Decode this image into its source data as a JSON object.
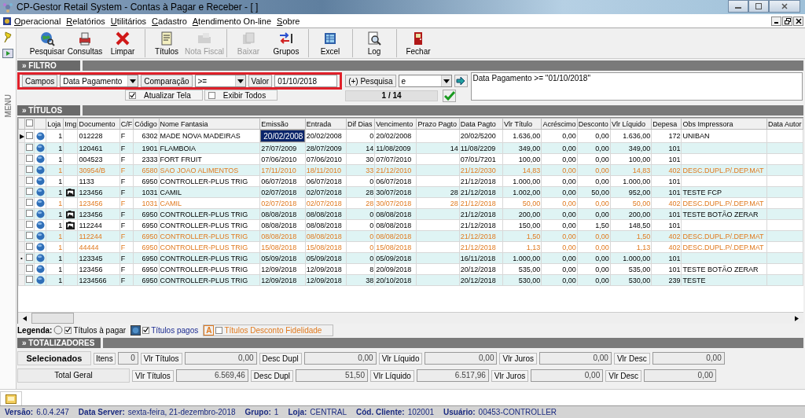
{
  "window": {
    "title": "CP-Gestor Retail System - Contas à Pagar e Receber - [ ]"
  },
  "menu": [
    "Operacional",
    "Relatórios",
    "Utilitários",
    "Cadastro",
    "Atendimento On-line",
    "Sobre"
  ],
  "side_panel": {
    "label": "MENU"
  },
  "toolbar": [
    {
      "label": "Pesquisar",
      "disabled": false,
      "separator_before": false
    },
    {
      "label": "Consultas",
      "disabled": false,
      "separator_before": false
    },
    {
      "label": "Limpar",
      "disabled": false,
      "separator_before": false
    },
    {
      "label": "Títulos",
      "disabled": false,
      "separator_before": true
    },
    {
      "label": "Nota Fiscal",
      "disabled": true,
      "separator_before": false
    },
    {
      "label": "Baixar",
      "disabled": true,
      "separator_before": true
    },
    {
      "label": "Grupos",
      "disabled": false,
      "separator_before": false
    },
    {
      "label": "Excel",
      "disabled": false,
      "separator_before": true
    },
    {
      "label": "Log",
      "disabled": false,
      "separator_before": true
    },
    {
      "label": "Fechar",
      "disabled": false,
      "separator_before": true
    }
  ],
  "filter": {
    "title": "» FILTRO",
    "field_button": "Campos",
    "field_value": "Data Pagamento",
    "compare_button": "Comparação",
    "compare_value": ">=",
    "value_button": "Valor",
    "value": "01/10/2018",
    "add_button": "(+) Pesquisa",
    "joiner_value": "e",
    "refresh": {
      "label": "Atualizar Tela",
      "checked": true
    },
    "show_all": {
      "label": "Exibir Todos",
      "checked": false
    },
    "counter": "1 / 14",
    "expression": "Data Pagamento >= \"01/10/2018\""
  },
  "titles": {
    "title": "» TÍTULOS",
    "header_checked": false,
    "columns": [
      {
        "label": "Loja",
        "kind": "text"
      },
      {
        "label": "Img",
        "kind": "image"
      },
      {
        "label": "Documento",
        "kind": "text"
      },
      {
        "label": "C/F",
        "kind": "text"
      },
      {
        "label": "Código",
        "kind": "text"
      },
      {
        "label": "Nome Fantasia",
        "kind": "text"
      },
      {
        "label": "Emissão",
        "kind": "text"
      },
      {
        "label": "Entrada",
        "kind": "text"
      },
      {
        "label": "Dif Dias",
        "kind": "text"
      },
      {
        "label": "Vencimento",
        "kind": "text"
      },
      {
        "label": "Prazo Pagto",
        "kind": "text"
      },
      {
        "label": "Data Pagto",
        "kind": "text"
      },
      {
        "label": "Vlr Título",
        "kind": "text"
      },
      {
        "label": "Acréscimo",
        "kind": "text"
      },
      {
        "label": "Desconto",
        "kind": "text"
      },
      {
        "label": "Vlr Líquido",
        "kind": "text"
      },
      {
        "label": "Depesa",
        "kind": "text"
      },
      {
        "label": "Obs Impressora",
        "kind": "text"
      },
      {
        "label": "Data Autor",
        "kind": "text"
      }
    ],
    "rows": [
      {
        "pointer": "▶",
        "selected": true,
        "checked": false,
        "image": false,
        "discount": false,
        "cells": [
          "1",
          null,
          "012228",
          "F",
          "6302",
          "MADE NOVA MADEIRAS",
          "20/02/2008",
          "20/02/2008",
          "0",
          "20/02/2008",
          null,
          "20/02/5200",
          "1.636,00",
          "0,00",
          "0,00",
          "1.636,00",
          "172",
          "UNIBAN",
          null
        ]
      },
      {
        "selected": false,
        "checked": false,
        "image": false,
        "discount": false,
        "cells": [
          "1",
          null,
          "120461",
          "F",
          "1901",
          "FLAMBOIA",
          "27/07/2009",
          "28/07/2009",
          "14",
          "11/08/2009",
          "14",
          "11/08/2209",
          "349,00",
          "0,00",
          "0,00",
          "349,00",
          "101",
          null,
          null
        ]
      },
      {
        "selected": false,
        "checked": false,
        "image": false,
        "discount": false,
        "cells": [
          "1",
          null,
          "004523",
          "F",
          "2333",
          "FORT FRUIT",
          "07/06/2010",
          "07/06/2010",
          "30",
          "07/07/2010",
          null,
          "07/01/7201",
          "100,00",
          "0,00",
          "0,00",
          "100,00",
          "101",
          null,
          null
        ]
      },
      {
        "selected": false,
        "checked": false,
        "image": false,
        "discount": true,
        "cells": [
          "1",
          null,
          "30954/B",
          "F",
          "6580",
          "SAO JOAO ALIMENTOS",
          "17/11/2010",
          "18/11/2010",
          "33",
          "21/12/2010",
          null,
          "21/12/2030",
          "14,83",
          "0,00",
          "0,00",
          "14,83",
          "402",
          "DESC.DUPL.P/.DEP.MAT",
          null
        ]
      },
      {
        "selected": false,
        "checked": false,
        "image": false,
        "discount": false,
        "cells": [
          "1",
          null,
          "1133",
          "F",
          "6950",
          "CONTROLLER-PLUS TRIG",
          "06/07/2018",
          "06/07/2018",
          "0",
          "06/07/2018",
          null,
          "21/12/2018",
          "1.000,00",
          "0,00",
          "0,00",
          "1.000,00",
          "101",
          null,
          null
        ]
      },
      {
        "selected": false,
        "checked": false,
        "image": true,
        "discount": false,
        "cells": [
          "1",
          null,
          "123456",
          "F",
          "1031",
          "CAMIL",
          "02/07/2018",
          "02/07/2018",
          "28",
          "30/07/2018",
          "28",
          "21/12/2018",
          "1.002,00",
          "0,00",
          "50,00",
          "952,00",
          "101",
          "TESTE FCP",
          null
        ]
      },
      {
        "selected": false,
        "checked": false,
        "image": false,
        "discount": true,
        "cells": [
          "1",
          null,
          "123456",
          "F",
          "1031",
          "CAMIL",
          "02/07/2018",
          "02/07/2018",
          "28",
          "30/07/2018",
          "28",
          "21/12/2018",
          "50,00",
          "0,00",
          "0,00",
          "50,00",
          "402",
          "DESC.DUPL.P/.DEP.MAT",
          null
        ]
      },
      {
        "selected": false,
        "checked": false,
        "image": true,
        "discount": false,
        "cells": [
          "1",
          null,
          "123456",
          "F",
          "6950",
          "CONTROLLER-PLUS TRIG",
          "08/08/2018",
          "08/08/2018",
          "0",
          "08/08/2018",
          null,
          "21/12/2018",
          "200,00",
          "0,00",
          "0,00",
          "200,00",
          "101",
          "TESTE BOTÃO ZERAR",
          null
        ]
      },
      {
        "selected": false,
        "checked": false,
        "image": true,
        "discount": false,
        "cells": [
          "1",
          null,
          "112244",
          "F",
          "6950",
          "CONTROLLER-PLUS TRIG",
          "08/08/2018",
          "08/08/2018",
          "0",
          "08/08/2018",
          null,
          "21/12/2018",
          "150,00",
          "0,00",
          "1,50",
          "148,50",
          "101",
          null,
          null
        ]
      },
      {
        "selected": false,
        "checked": false,
        "image": false,
        "discount": true,
        "cells": [
          "1",
          null,
          "112244",
          "F",
          "6950",
          "CONTROLLER-PLUS TRIG",
          "08/08/2018",
          "08/08/2018",
          "0",
          "08/08/2018",
          null,
          "21/12/2018",
          "1,50",
          "0,00",
          "0,00",
          "1,50",
          "402",
          "DESC.DUPL.P/.DEP.MAT",
          null
        ]
      },
      {
        "selected": false,
        "checked": false,
        "image": false,
        "discount": true,
        "cells": [
          "1",
          null,
          "44444",
          "F",
          "6950",
          "CONTROLLER-PLUS TRIG",
          "15/08/2018",
          "15/08/2018",
          "0",
          "15/08/2018",
          null,
          "21/12/2018",
          "1,13",
          "0,00",
          "0,00",
          "1,13",
          "402",
          "DESC.DUPL.P/.DEP.MAT",
          null
        ]
      },
      {
        "pointer": "•",
        "selected": false,
        "checked": false,
        "image": false,
        "discount": false,
        "cells": [
          "1",
          null,
          "123345",
          "F",
          "6950",
          "CONTROLLER-PLUS TRIG",
          "05/09/2018",
          "05/09/2018",
          "0",
          "05/09/2018",
          null,
          "16/11/2018",
          "1.000,00",
          "0,00",
          "0,00",
          "1.000,00",
          "101",
          null,
          null
        ]
      },
      {
        "selected": false,
        "checked": false,
        "image": false,
        "discount": false,
        "cells": [
          "1",
          null,
          "123456",
          "F",
          "6950",
          "CONTROLLER-PLUS TRIG",
          "12/09/2018",
          "12/09/2018",
          "8",
          "20/09/2018",
          null,
          "20/12/2018",
          "535,00",
          "0,00",
          "0,00",
          "535,00",
          "101",
          "TESTE BOTÃO ZERAR",
          null
        ]
      },
      {
        "selected": false,
        "checked": false,
        "image": false,
        "discount": false,
        "cells": [
          "1",
          null,
          "1234566",
          "F",
          "6950",
          "CONTROLLER-PLUS TRIG",
          "12/09/2018",
          "12/09/2018",
          "38",
          "20/10/2018",
          null,
          "20/12/2018",
          "530,00",
          "0,00",
          "0,00",
          "530,00",
          "239",
          "TESTE",
          null
        ]
      }
    ]
  },
  "legend": {
    "label": "Legenda:",
    "items": [
      {
        "kind": "open",
        "label": "Títulos à pagar",
        "checked": true
      },
      {
        "kind": "paid",
        "label": "Títulos pagos",
        "checked": true
      },
      {
        "kind": "discount",
        "marker": "A",
        "label": "Títulos Desconto Fidelidade",
        "checked": false
      }
    ]
  },
  "totals": {
    "title": "» TOTALIZADORES",
    "rows": [
      {
        "kind": "selected",
        "label": "Selecionados",
        "count_label": "Itens",
        "count": "0",
        "fields": [
          {
            "label": "Vlr Títulos",
            "value": "0,00"
          },
          {
            "label": "Desc Dupl",
            "value": "0,00"
          },
          {
            "label": "Vlr Líquido",
            "value": "0,00"
          },
          {
            "label": "Vlr Juros",
            "value": "0,00"
          },
          {
            "label": "Vlr Desc",
            "value": "0,00"
          }
        ]
      },
      {
        "kind": "total",
        "label": "Total Geral",
        "fields": [
          {
            "label": "Vlr Títulos",
            "value": "6.569,46"
          },
          {
            "label": "Desc Dupl",
            "value": "51,50"
          },
          {
            "label": "Vlr Líquido",
            "value": "6.517,96"
          },
          {
            "label": "Vlr Juros",
            "value": "0,00"
          },
          {
            "label": "Vlr Desc",
            "value": "0,00"
          }
        ]
      }
    ]
  },
  "status_bar": [
    {
      "label": "Versão:",
      "value": "6.0.4.247"
    },
    {
      "label": "Data Server:",
      "value": "sexta-feira, 21-dezembro-2018"
    },
    {
      "label": "Grupo:",
      "value": "1"
    },
    {
      "label": "Loja:",
      "value": "CENTRAL"
    },
    {
      "label": "Cód. Cliente:",
      "value": "102001"
    },
    {
      "label": "Usuário:",
      "value": "00453-CONTROLLER"
    }
  ]
}
